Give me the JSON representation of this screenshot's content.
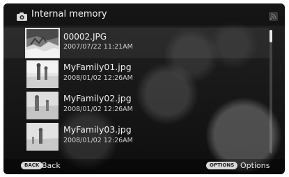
{
  "header": {
    "title": "Internal memory",
    "left_icon": "camera-icon",
    "right_icon": "signal-icon"
  },
  "files": [
    {
      "name": "00002.JPG",
      "date": "2007/07/22 11:21AM",
      "selected": true
    },
    {
      "name": "MyFamily01.jpg",
      "date": "2008/01/02 12:26AM",
      "selected": false
    },
    {
      "name": "MyFamily02.jpg",
      "date": "2008/01/02 12:26AM",
      "selected": false
    },
    {
      "name": "MyFamily03.jpg",
      "date": "2008/01/02 12:26AM",
      "selected": false
    }
  ],
  "footer": {
    "back_key": "BACK",
    "back_label": "Back",
    "options_key": "OPTIONS",
    "options_label": "Options"
  }
}
